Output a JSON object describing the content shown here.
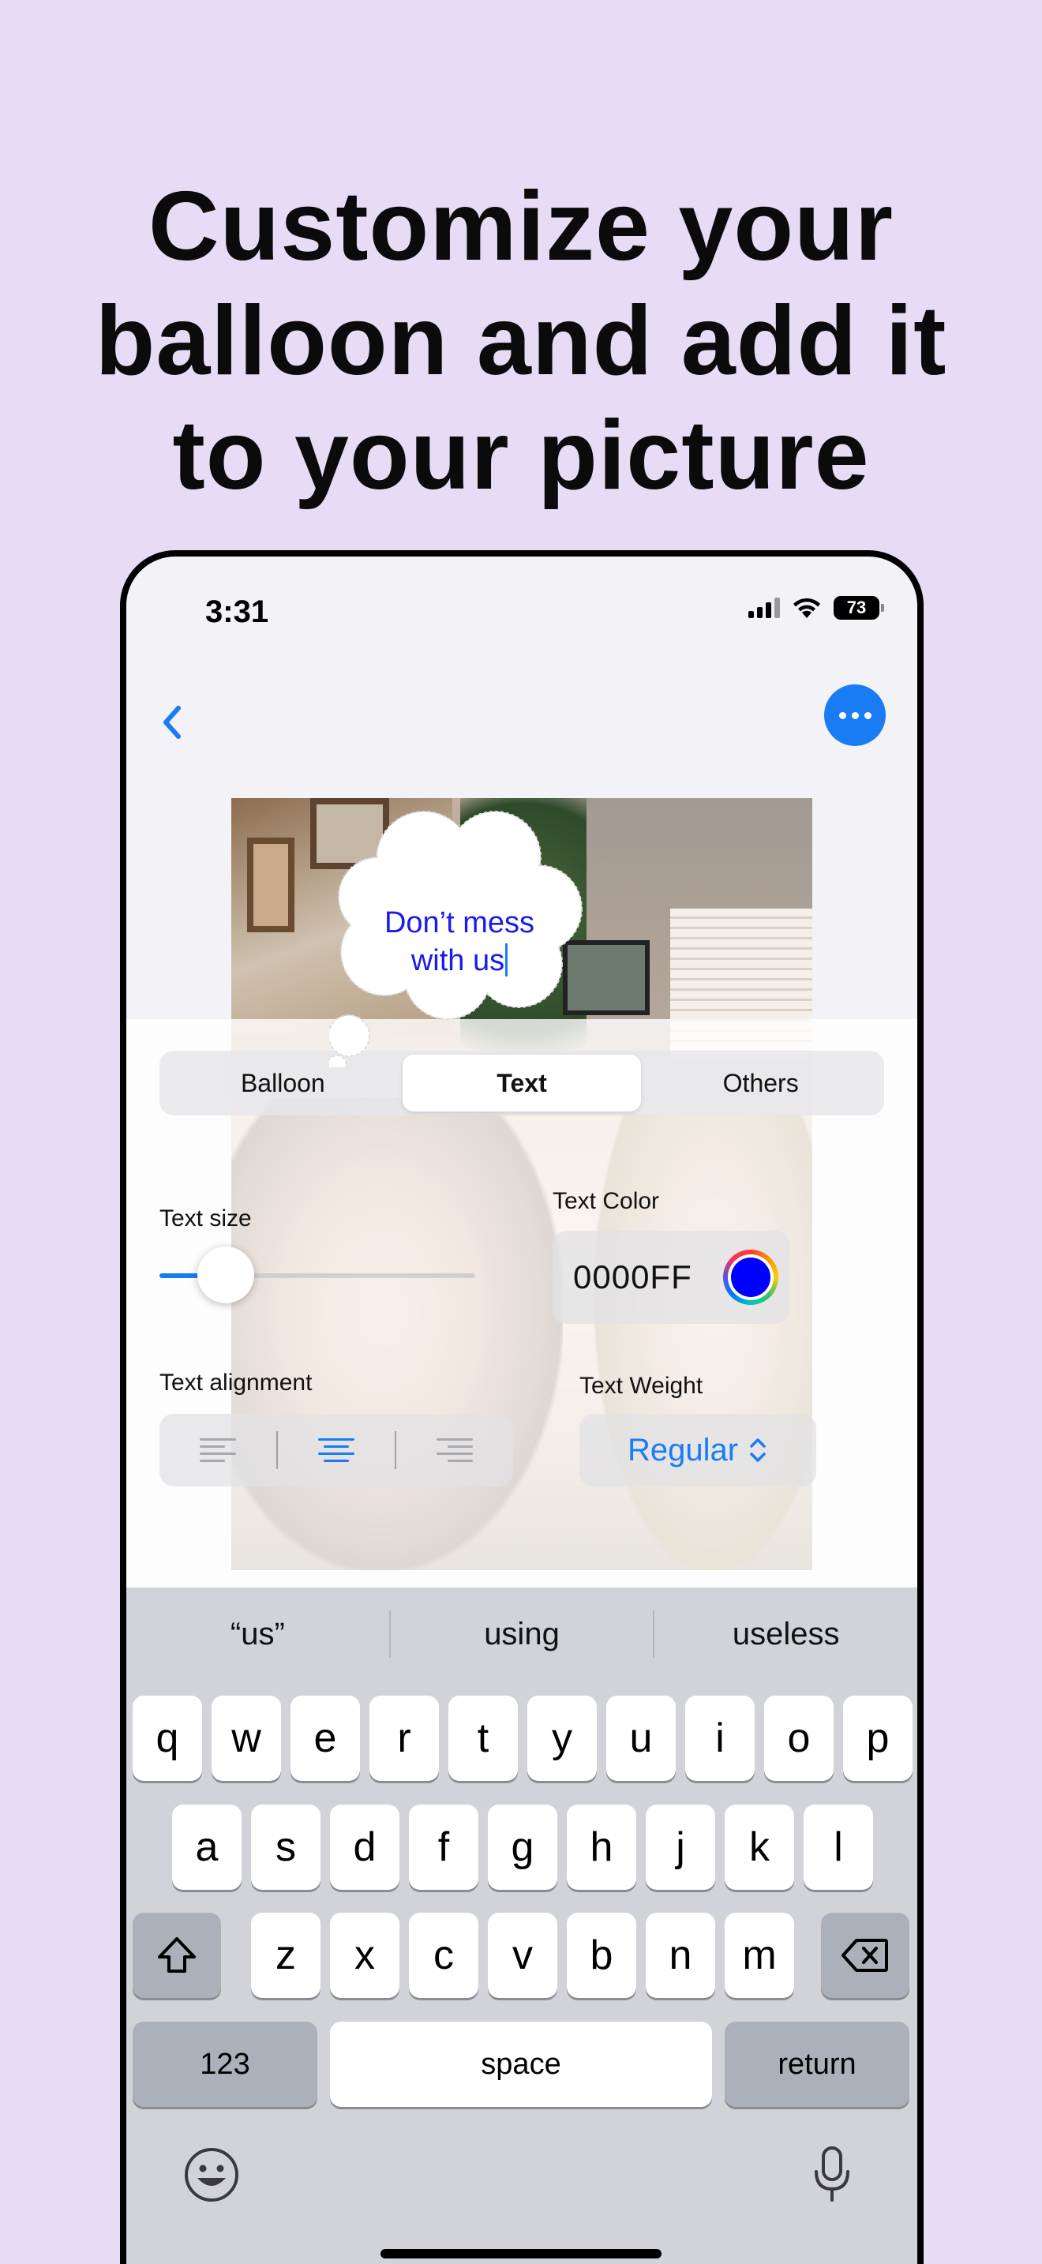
{
  "headline": [
    "Customize your",
    "balloon and add it",
    "to your picture"
  ],
  "status": {
    "time": "3:31",
    "battery": "73"
  },
  "balloon": {
    "line1": "Don’t mess",
    "line2": "with us"
  },
  "tabs": [
    {
      "label": "Balloon",
      "active": false
    },
    {
      "label": "Text",
      "active": true
    },
    {
      "label": "Others",
      "active": false
    }
  ],
  "text_size": {
    "label": "Text size",
    "value_fraction": 0.12
  },
  "text_color": {
    "label": "Text Color",
    "hex": "0000FF",
    "color": "#0000FF"
  },
  "text_alignment": {
    "label": "Text alignment",
    "options": [
      "left",
      "center",
      "right"
    ],
    "selected": "center"
  },
  "text_weight": {
    "label": "Text Weight",
    "value": "Regular"
  },
  "keyboard": {
    "suggestions": [
      "“us”",
      "using",
      "useless"
    ],
    "row1": [
      "q",
      "w",
      "e",
      "r",
      "t",
      "y",
      "u",
      "i",
      "o",
      "p"
    ],
    "row2": [
      "a",
      "s",
      "d",
      "f",
      "g",
      "h",
      "j",
      "k",
      "l"
    ],
    "row3": [
      "z",
      "x",
      "c",
      "v",
      "b",
      "n",
      "m"
    ],
    "numbers_key": "123",
    "space_key": "space",
    "return_key": "return"
  },
  "colors": {
    "accent": "#1A7CF5",
    "background": "#E6DCF5"
  }
}
